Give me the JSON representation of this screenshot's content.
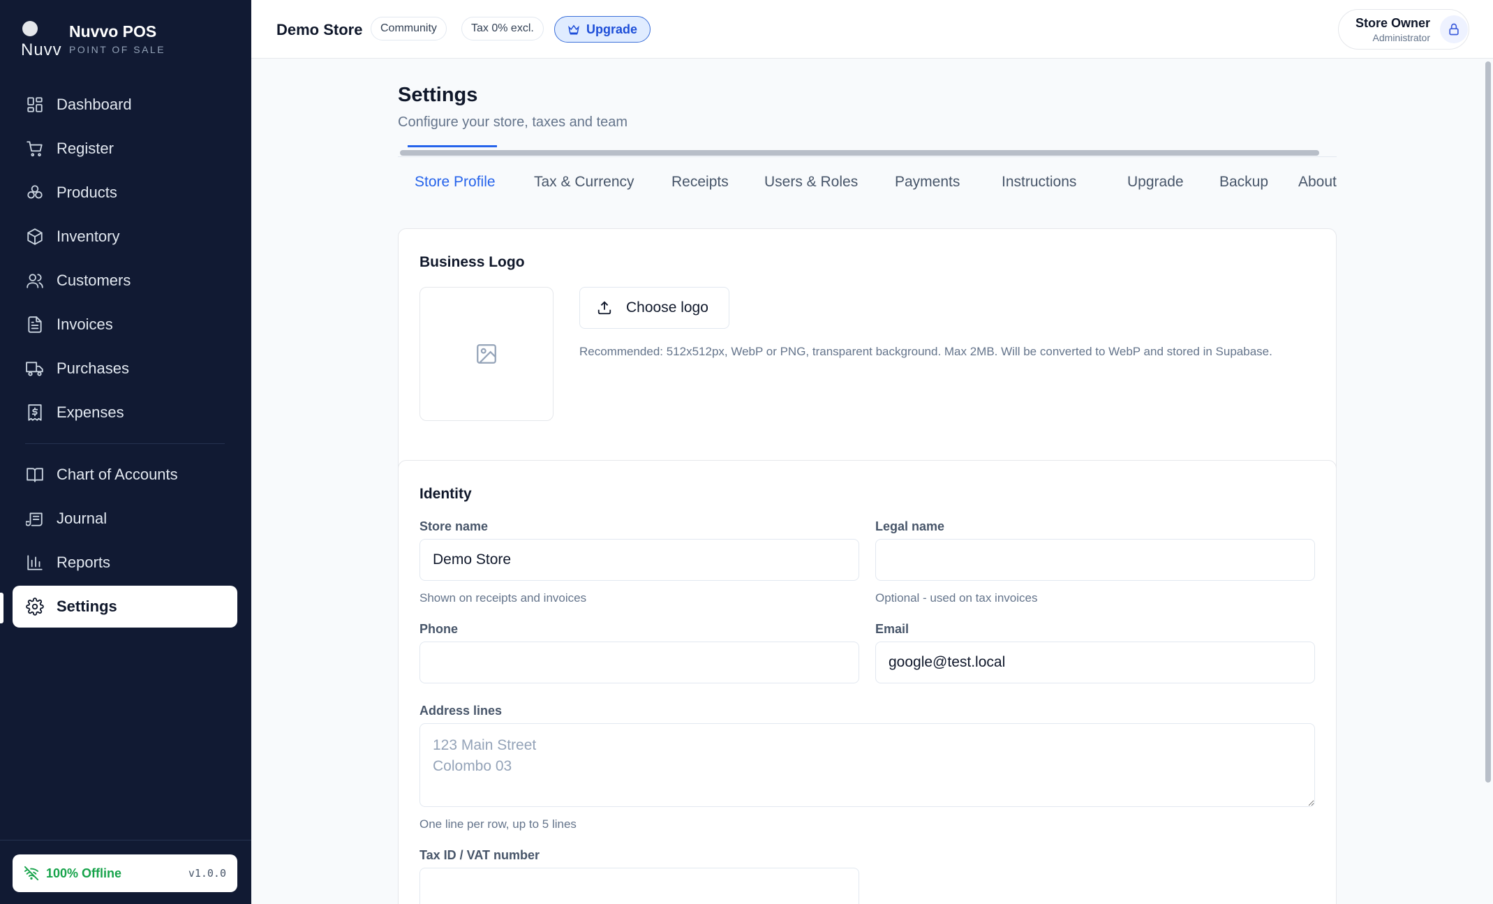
{
  "brand": {
    "logo_text": "Nuvv",
    "name": "Nuvvo POS",
    "subtitle": "POINT OF SALE"
  },
  "nav": {
    "items": [
      {
        "label": "Dashboard",
        "icon": "dashboard-icon"
      },
      {
        "label": "Register",
        "icon": "cart-icon"
      },
      {
        "label": "Products",
        "icon": "products-icon"
      },
      {
        "label": "Inventory",
        "icon": "box-icon"
      },
      {
        "label": "Customers",
        "icon": "users-icon"
      },
      {
        "label": "Invoices",
        "icon": "file-icon"
      },
      {
        "label": "Purchases",
        "icon": "truck-icon"
      },
      {
        "label": "Expenses",
        "icon": "receipt-dollar-icon"
      }
    ],
    "accounting": [
      {
        "label": "Chart of Accounts",
        "icon": "book-icon"
      },
      {
        "label": "Journal",
        "icon": "scroll-icon"
      },
      {
        "label": "Reports",
        "icon": "bar-chart-icon"
      },
      {
        "label": "Settings",
        "icon": "gear-icon",
        "active": true
      }
    ]
  },
  "footer": {
    "status": "100% Offline",
    "version": "v1.0.0",
    "status_color": "#16a34a"
  },
  "topbar": {
    "store": "Demo Store",
    "plan_badge": "Community",
    "tax_badge": "Tax 0% excl.",
    "upgrade_label": "Upgrade",
    "user_name": "Store Owner",
    "user_role": "Administrator"
  },
  "page": {
    "title": "Settings",
    "subtitle": "Configure your store, taxes and team",
    "tabs": [
      "Store Profile",
      "Tax & Currency",
      "Receipts",
      "Users & Roles",
      "Payments",
      "Instructions",
      "Upgrade",
      "Backup",
      "About"
    ],
    "active_tab": "Store Profile"
  },
  "logo_card": {
    "title": "Business Logo",
    "choose_label": "Choose logo",
    "hint": "Recommended: 512x512px, WebP or PNG, transparent background. Max 2MB. Will be converted to WebP and stored in Supabase."
  },
  "identity": {
    "title": "Identity",
    "store_name": {
      "label": "Store name",
      "value": "Demo Store",
      "help": "Shown on receipts and invoices"
    },
    "legal_name": {
      "label": "Legal name",
      "value": "",
      "help": "Optional - used on tax invoices"
    },
    "phone": {
      "label": "Phone",
      "value": ""
    },
    "email": {
      "label": "Email",
      "value": "google@test.local"
    },
    "address": {
      "label": "Address lines",
      "placeholder": "123 Main Street\nColombo 03",
      "help": "One line per row, up to 5 lines"
    },
    "tax_id": {
      "label": "Tax ID / VAT number",
      "value": ""
    }
  },
  "colors": {
    "sidebar_bg": "#111a33",
    "accent": "#2563eb",
    "page_bg": "#f8fafc"
  }
}
